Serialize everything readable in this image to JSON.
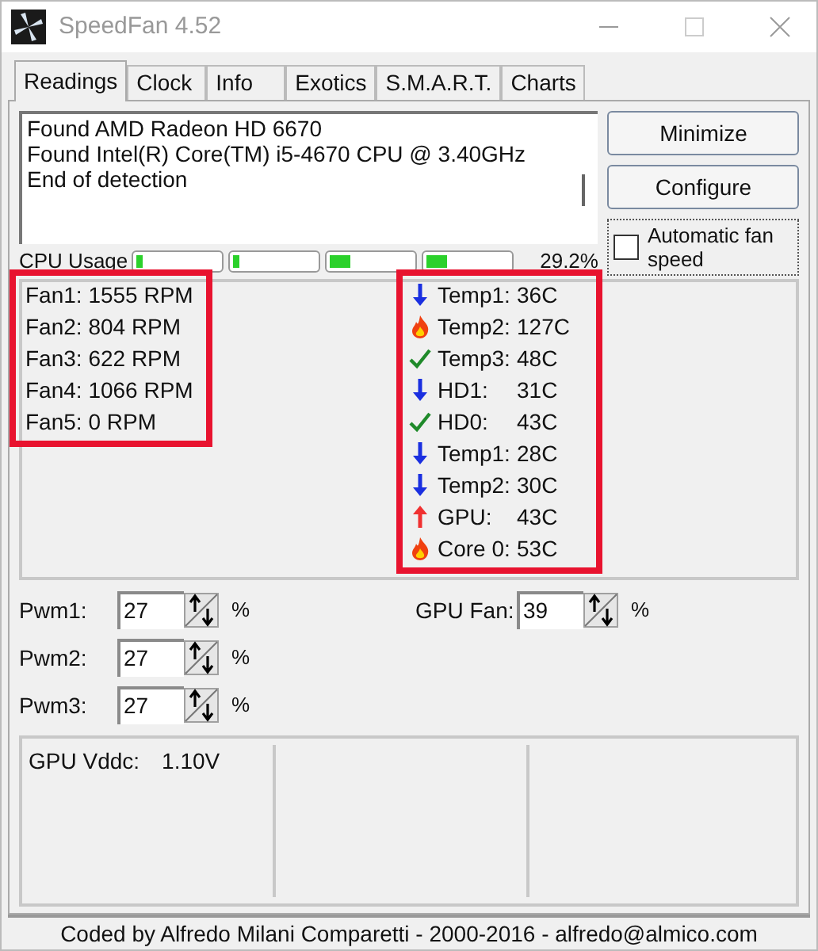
{
  "window": {
    "title": "SpeedFan 4.52"
  },
  "tabs": [
    {
      "label": "Readings",
      "selected": true
    },
    {
      "label": "Clock",
      "selected": false
    },
    {
      "label": "Info",
      "selected": false
    },
    {
      "label": "Exotics",
      "selected": false
    },
    {
      "label": "S.M.A.R.T.",
      "selected": false
    },
    {
      "label": "Charts",
      "selected": false
    }
  ],
  "log": [
    "Found AMD Radeon HD 6670",
    "Found Intel(R) Core(TM) i5-4670 CPU @ 3.40GHz",
    "End of detection"
  ],
  "buttons": [
    "Minimize",
    "Configure"
  ],
  "auto_fan": {
    "label": "Automatic fan speed",
    "checked": false
  },
  "cpu_usage": {
    "label": "CPU Usage",
    "cores": [
      {
        "level": 0.08
      },
      {
        "level": 0.08
      },
      {
        "level": 0.25
      },
      {
        "level": 0.25
      }
    ],
    "reading": "29.2%"
  },
  "fans": [
    "Fan1: 1555 RPM",
    "Fan2: 804 RPM",
    "Fan3: 622 RPM",
    "Fan4: 1066 RPM",
    "Fan5: 0 RPM"
  ],
  "temps": [
    {
      "kind": "down",
      "label": "Temp1:",
      "value": "36C"
    },
    {
      "kind": "hot",
      "label": "Temp2:",
      "value": "127C"
    },
    {
      "kind": "ok",
      "label": "Temp3:",
      "value": "48C"
    },
    {
      "kind": "down",
      "label": "HD1:",
      "value": "31C"
    },
    {
      "kind": "ok",
      "label": "HD0:",
      "value": "43C"
    },
    {
      "kind": "down",
      "label": "Temp1:",
      "value": "28C"
    },
    {
      "kind": "down",
      "label": "Temp2:",
      "value": "30C"
    },
    {
      "kind": "up",
      "label": "GPU:",
      "value": "43C"
    },
    {
      "kind": "hot",
      "label": "Core 0:",
      "value": "53C"
    }
  ],
  "pwm": [
    {
      "label": "Pwm1:",
      "value": "27",
      "unit": "%"
    },
    {
      "label": "Pwm2:",
      "value": "27",
      "unit": "%"
    },
    {
      "label": "Pwm3:",
      "value": "27",
      "unit": "%"
    }
  ],
  "gpu_fan": {
    "label": "GPU Fan:",
    "value": "39",
    "unit": "%"
  },
  "voltages": [
    {
      "label": "GPU Vddc:",
      "value": "1.10V"
    }
  ],
  "status_bar": "Coded by Alfredo Milani Comparetti - 2000-2016 - alfredo@almico.com"
}
